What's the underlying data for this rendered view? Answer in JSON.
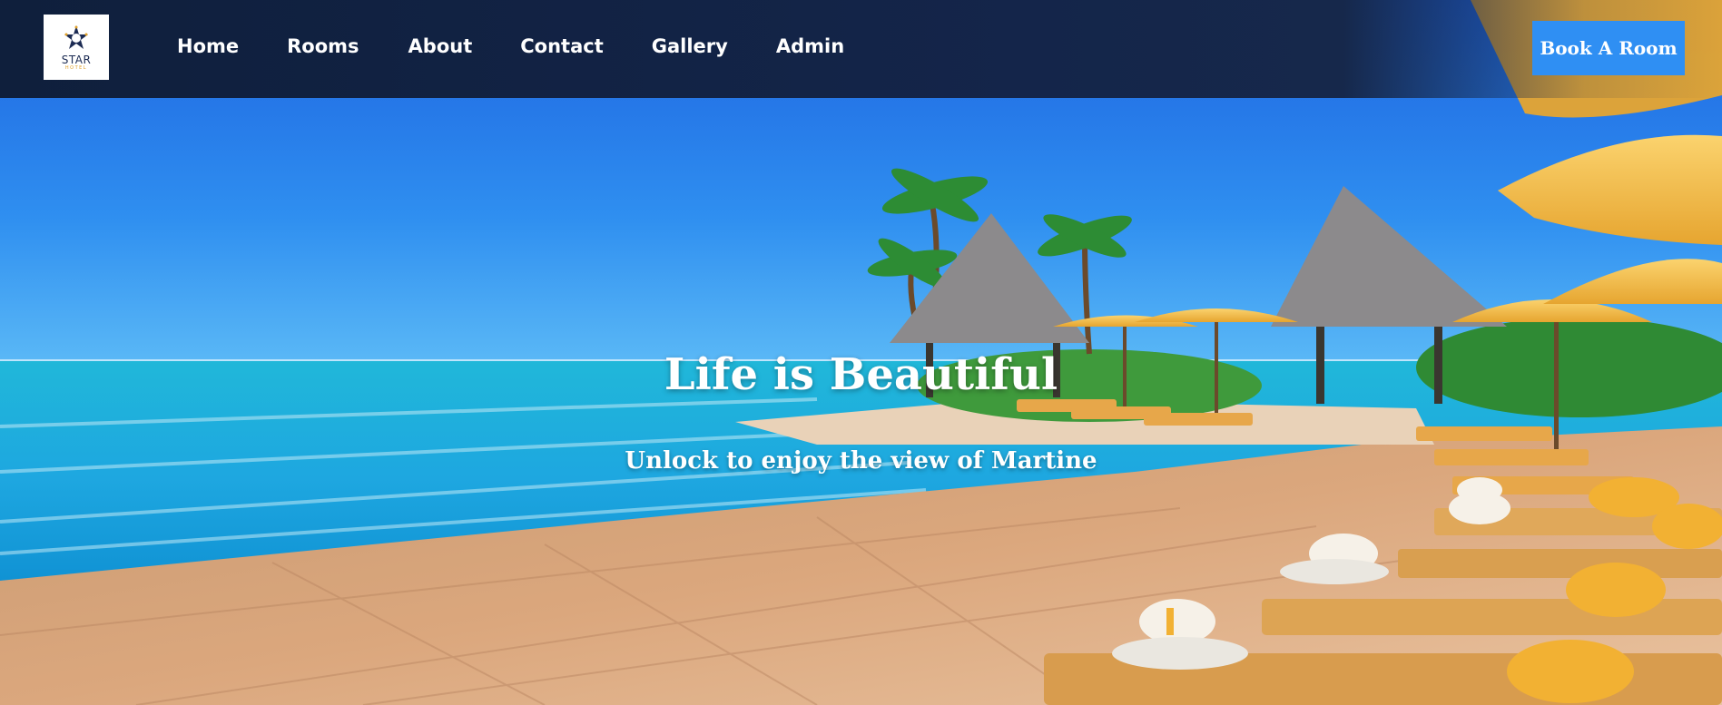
{
  "logo": {
    "word": "STAR",
    "sub": "HOTEL"
  },
  "nav": {
    "items": [
      {
        "label": "Home"
      },
      {
        "label": "Rooms"
      },
      {
        "label": "About"
      },
      {
        "label": "Contact"
      },
      {
        "label": "Gallery"
      },
      {
        "label": "Admin"
      }
    ],
    "book_label": "Book A Room"
  },
  "hero": {
    "title": "Life is Beautiful",
    "subtitle": "Unlock to enjoy the view of Martine",
    "image": "tropical-resort-pool-icon"
  },
  "colors": {
    "navbar": "#14254a",
    "button": "#2f8ff3",
    "text": "#ffffff"
  }
}
